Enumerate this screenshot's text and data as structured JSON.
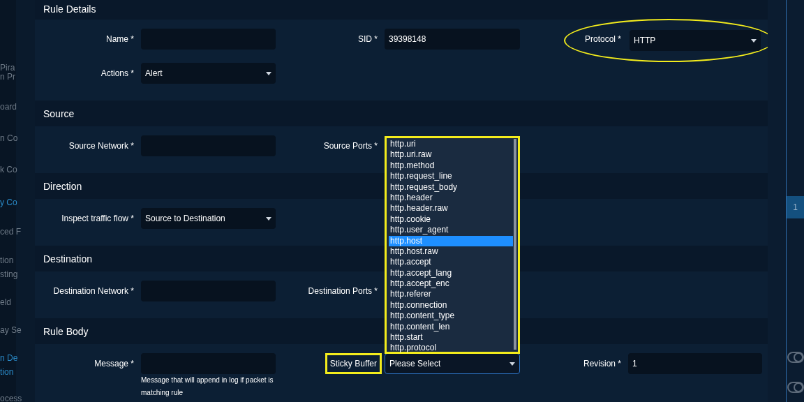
{
  "sidebar": [
    {
      "label": "Pira",
      "active": false
    },
    {
      "label": "n Pr",
      "active": false
    },
    {
      "label": "oard",
      "active": false
    },
    {
      "label": "n Co",
      "active": false
    },
    {
      "label": "k Co",
      "active": false
    },
    {
      "label": "y Co",
      "active": true
    },
    {
      "label": "ced F",
      "active": false
    },
    {
      "label": "tion",
      "active": false
    },
    {
      "label": "sting",
      "active": false
    },
    {
      "label": "eld",
      "active": false
    },
    {
      "label": "ay Se",
      "active": false
    },
    {
      "label": "n De",
      "active": true
    },
    {
      "label": "tion",
      "active": true
    },
    {
      "label": "ocess",
      "active": false
    }
  ],
  "sections": [
    {
      "title": "Rule Details",
      "rows": [
        [
          {
            "label": "Name *",
            "kind": "text"
          },
          {
            "label": "SID *",
            "kind": "text",
            "value": "39398148"
          },
          {
            "label": "Protocol *",
            "kind": "select",
            "value": "HTTP",
            "highlighted": true
          }
        ],
        [
          {
            "label": "Actions *",
            "kind": "select",
            "value": "Alert"
          }
        ]
      ]
    },
    {
      "title": "Source",
      "rows": [
        [
          {
            "label": "Source Network *",
            "kind": "text"
          },
          {
            "label": "Source Ports *",
            "kind": "covered"
          }
        ]
      ]
    },
    {
      "title": "Direction",
      "rows": [
        [
          {
            "label": "Inspect traffic flow *",
            "kind": "select",
            "value": "Source to Destination"
          }
        ]
      ]
    },
    {
      "title": "Destination",
      "rows": [
        [
          {
            "label": "Destination Network *",
            "kind": "text"
          },
          {
            "label": "Destination Ports *",
            "kind": "covered"
          }
        ]
      ]
    },
    {
      "title": "Rule Body",
      "rows": [
        [
          {
            "label": "Message *",
            "kind": "text",
            "help": "Message that will append in log if packet is matching rule"
          },
          {
            "label": "Sticky Buffer",
            "kind": "select",
            "value": "Please Select",
            "focused": true,
            "highlighted": true
          },
          {
            "label": "Revision *",
            "kind": "text",
            "value": "1"
          }
        ]
      ]
    }
  ],
  "listbox": {
    "annotated": true,
    "options": [
      {
        "label": "http.uri",
        "selected": false
      },
      {
        "label": "http.uri.raw",
        "selected": false
      },
      {
        "label": "http.method",
        "selected": false
      },
      {
        "label": "http.request_line",
        "selected": false
      },
      {
        "label": "http.request_body",
        "selected": false
      },
      {
        "label": "http.header",
        "selected": false
      },
      {
        "label": "http.header.raw",
        "selected": false
      },
      {
        "label": "http.cookie",
        "selected": false
      },
      {
        "label": "http.user_agent",
        "selected": false
      },
      {
        "label": "http.host",
        "selected": true
      },
      {
        "label": "http.host.raw",
        "selected": false
      },
      {
        "label": "http.accept",
        "selected": false
      },
      {
        "label": "http.accept_lang",
        "selected": false
      },
      {
        "label": "http.accept_enc",
        "selected": false
      },
      {
        "label": "http.referer",
        "selected": false
      },
      {
        "label": "http.connection",
        "selected": false
      },
      {
        "label": "http.content_type",
        "selected": false
      },
      {
        "label": "http.content_len",
        "selected": false
      },
      {
        "label": "http.start",
        "selected": false
      },
      {
        "label": "http.protocol",
        "selected": false
      }
    ]
  },
  "page_badge": "1"
}
